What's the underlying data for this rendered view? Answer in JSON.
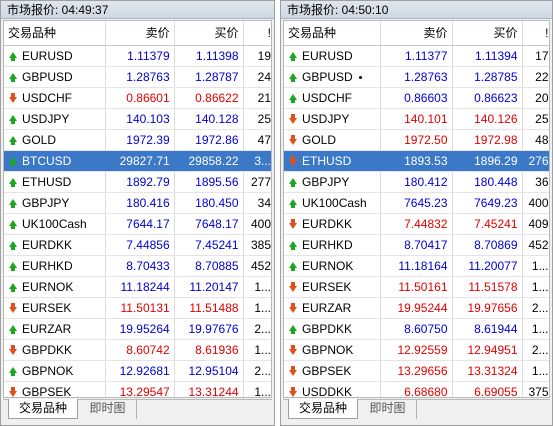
{
  "panels": [
    {
      "title": "市场报价: 04:49:37",
      "columns": {
        "symbol": "交易品种",
        "bid": "卖价",
        "ask": "买价",
        "spread": "!"
      },
      "rows": [
        {
          "symbol": "EURUSD",
          "bid": "1.11379",
          "ask": "1.11398",
          "spread": "19",
          "dir": "up"
        },
        {
          "symbol": "GBPUSD",
          "bid": "1.28763",
          "ask": "1.28787",
          "spread": "24",
          "dir": "up"
        },
        {
          "symbol": "USDCHF",
          "bid": "0.86601",
          "ask": "0.86622",
          "spread": "21",
          "dir": "down"
        },
        {
          "symbol": "USDJPY",
          "bid": "140.103",
          "ask": "140.128",
          "spread": "25",
          "dir": "up"
        },
        {
          "symbol": "GOLD",
          "bid": "1972.39",
          "ask": "1972.86",
          "spread": "47",
          "dir": "up"
        },
        {
          "symbol": "BTCUSD",
          "bid": "29827.71",
          "ask": "29858.22",
          "spread": "3...",
          "dir": "up",
          "selected": true
        },
        {
          "symbol": "ETHUSD",
          "bid": "1892.79",
          "ask": "1895.56",
          "spread": "277",
          "dir": "up"
        },
        {
          "symbol": "GBPJPY",
          "bid": "180.416",
          "ask": "180.450",
          "spread": "34",
          "dir": "up"
        },
        {
          "symbol": "UK100Cash",
          "bid": "7644.17",
          "ask": "7648.17",
          "spread": "400",
          "dir": "up"
        },
        {
          "symbol": "EURDKK",
          "bid": "7.44856",
          "ask": "7.45241",
          "spread": "385",
          "dir": "up"
        },
        {
          "symbol": "EURHKD",
          "bid": "8.70433",
          "ask": "8.70885",
          "spread": "452",
          "dir": "up"
        },
        {
          "symbol": "EURNOK",
          "bid": "11.18244",
          "ask": "11.20147",
          "spread": "1...",
          "dir": "up"
        },
        {
          "symbol": "EURSEK",
          "bid": "11.50131",
          "ask": "11.51488",
          "spread": "1...",
          "dir": "down"
        },
        {
          "symbol": "EURZAR",
          "bid": "19.95264",
          "ask": "19.97676",
          "spread": "2...",
          "dir": "up"
        },
        {
          "symbol": "GBPDKK",
          "bid": "8.60742",
          "ask": "8.61936",
          "spread": "1...",
          "dir": "down"
        },
        {
          "symbol": "GBPNOK",
          "bid": "12.92681",
          "ask": "12.95104",
          "spread": "2...",
          "dir": "up"
        },
        {
          "symbol": "GBPSEK",
          "bid": "13.29547",
          "ask": "13.31244",
          "spread": "1...",
          "dir": "down"
        }
      ],
      "tabs": [
        "交易品种",
        "即时图"
      ]
    },
    {
      "title": "市场报价: 04:50:10",
      "columns": {
        "symbol": "交易品种",
        "bid": "卖价",
        "ask": "买价",
        "spread": "!"
      },
      "rows": [
        {
          "symbol": "EURUSD",
          "bid": "1.11377",
          "ask": "1.11394",
          "spread": "17",
          "dir": "up"
        },
        {
          "symbol": "GBPUSD",
          "bid": "1.28763",
          "ask": "1.28785",
          "spread": "22",
          "dir": "up",
          "dot": true
        },
        {
          "symbol": "USDCHF",
          "bid": "0.86603",
          "ask": "0.86623",
          "spread": "20",
          "dir": "up"
        },
        {
          "symbol": "USDJPY",
          "bid": "140.101",
          "ask": "140.126",
          "spread": "25",
          "dir": "down"
        },
        {
          "symbol": "GOLD",
          "bid": "1972.50",
          "ask": "1972.98",
          "spread": "48",
          "dir": "down"
        },
        {
          "symbol": "ETHUSD",
          "bid": "1893.53",
          "ask": "1896.29",
          "spread": "276",
          "dir": "down",
          "selected": true
        },
        {
          "symbol": "GBPJPY",
          "bid": "180.412",
          "ask": "180.448",
          "spread": "36",
          "dir": "up"
        },
        {
          "symbol": "UK100Cash",
          "bid": "7645.23",
          "ask": "7649.23",
          "spread": "400",
          "dir": "up"
        },
        {
          "symbol": "EURDKK",
          "bid": "7.44832",
          "ask": "7.45241",
          "spread": "409",
          "dir": "down"
        },
        {
          "symbol": "EURHKD",
          "bid": "8.70417",
          "ask": "8.70869",
          "spread": "452",
          "dir": "up"
        },
        {
          "symbol": "EURNOK",
          "bid": "11.18164",
          "ask": "11.20077",
          "spread": "1...",
          "dir": "up"
        },
        {
          "symbol": "EURSEK",
          "bid": "11.50161",
          "ask": "11.51578",
          "spread": "1...",
          "dir": "down"
        },
        {
          "symbol": "EURZAR",
          "bid": "19.95244",
          "ask": "19.97656",
          "spread": "2...",
          "dir": "down"
        },
        {
          "symbol": "GBPDKK",
          "bid": "8.60750",
          "ask": "8.61944",
          "spread": "1...",
          "dir": "up"
        },
        {
          "symbol": "GBPNOK",
          "bid": "12.92559",
          "ask": "12.94951",
          "spread": "2...",
          "dir": "down"
        },
        {
          "symbol": "GBPSEK",
          "bid": "13.29656",
          "ask": "13.31324",
          "spread": "1...",
          "dir": "down"
        },
        {
          "symbol": "USDDKK",
          "bid": "6.68680",
          "ask": "6.69055",
          "spread": "375",
          "dir": "down"
        }
      ],
      "tabs": [
        "交易品种",
        "即时图"
      ]
    }
  ],
  "colors": {
    "up_price": "#0000d0",
    "down_price": "#e00000",
    "up_arrow": "#1ea61e",
    "down_arrow": "#e0501c",
    "selection": "#3b79c8"
  }
}
